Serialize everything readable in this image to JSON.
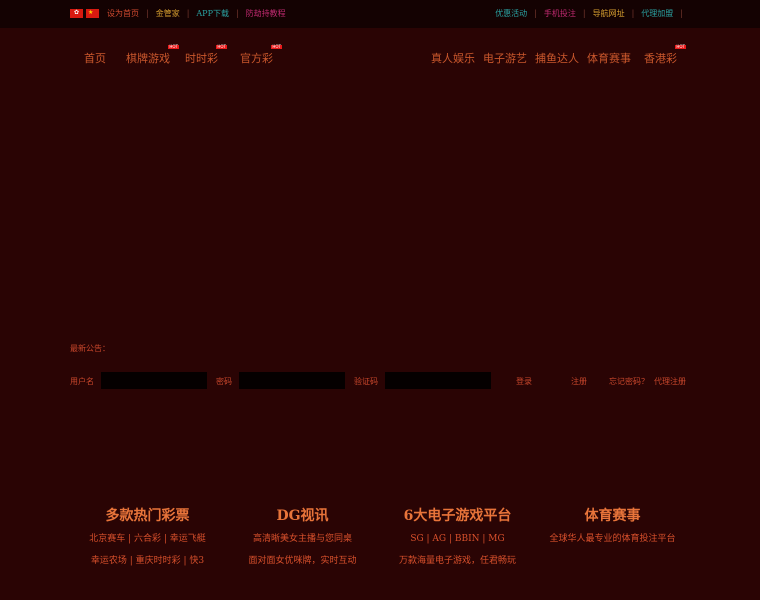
{
  "topbar": {
    "left_links": [
      "设为首页",
      "金管家",
      "APP下载",
      "防劫持教程"
    ],
    "right_links": [
      "优惠活动",
      "手机投注",
      "导航网址",
      "代理加盟"
    ]
  },
  "nav": {
    "left": [
      {
        "label": "首页",
        "hot": false
      },
      {
        "label": "棋牌游戏",
        "hot": true
      },
      {
        "label": "时时彩",
        "hot": true
      },
      {
        "label": "官方彩",
        "hot": true
      }
    ],
    "right": [
      {
        "label": "真人娱乐",
        "hot": false
      },
      {
        "label": "电子游艺",
        "hot": false
      },
      {
        "label": "捕鱼达人",
        "hot": false
      },
      {
        "label": "体育赛事",
        "hot": false
      },
      {
        "label": "香港彩",
        "hot": true
      }
    ],
    "hot_badge": "HOT"
  },
  "notice": {
    "label": "最新公告："
  },
  "login": {
    "username_label": "用户名",
    "password_label": "密码",
    "captcha_label": "验证码",
    "login_label": "登录",
    "register_label": "注册",
    "forgot_label": "忘记密码？",
    "agent_register_label": "代理注册"
  },
  "features": [
    {
      "title": "多款热门彩票",
      "line1": "北京赛车 | 六合彩 | 幸运飞艇",
      "line2": "幸运农场 | 重庆时时彩 | 快3"
    },
    {
      "title": "DG视讯",
      "line1": "高清晰美女主播与您同桌",
      "line2": "面对面女优咪牌，实时互动"
    },
    {
      "title": "6大电子游戏平台",
      "line1": "SG | AG | BBIN | MG",
      "line2": "万款海量电子游戏，任君畅玩"
    },
    {
      "title": "体育赛事",
      "line1": "全球华人最专业的体育投注平台",
      "line2": ""
    }
  ]
}
